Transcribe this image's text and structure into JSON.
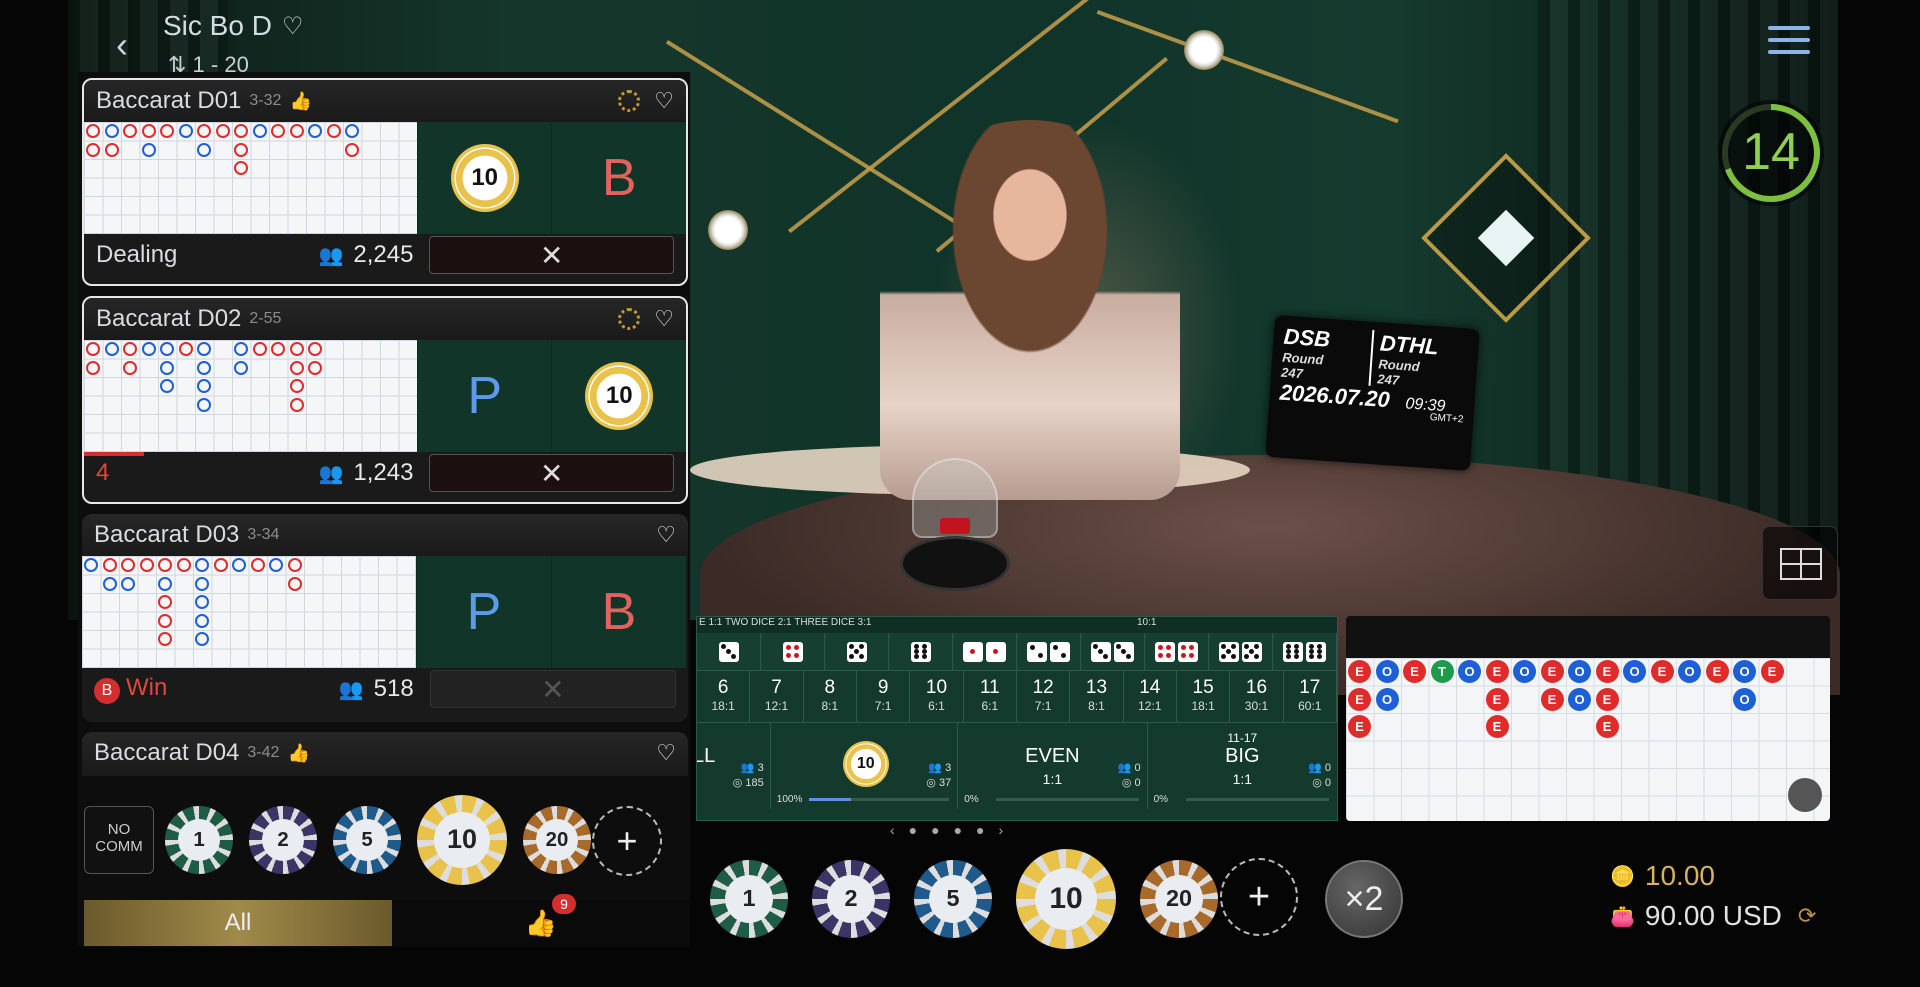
{
  "header": {
    "title": "Sic Bo D",
    "limits": "1 - 20",
    "timer": "14"
  },
  "studio_board": {
    "left_label": "DSB",
    "left_round_label": "Round",
    "left_round": "247",
    "right_label": "DTHL",
    "right_round_label": "Round",
    "right_round": "247",
    "date": "2026.07.20",
    "time": "09:39",
    "tz": "GMT+2"
  },
  "lobby": {
    "cards": [
      {
        "name": "Baccarat D01",
        "limit": "3-32",
        "status": "Dealing",
        "players": "2,245",
        "left_cell": "10",
        "right_cell": "B"
      },
      {
        "name": "Baccarat D02",
        "limit": "2-55",
        "status": "4",
        "players": "1,243",
        "left_cell": "P",
        "right_cell": "10"
      },
      {
        "name": "Baccarat D03",
        "limit": "3-34",
        "status": "Win",
        "status_badge": "B",
        "players": "518",
        "left_cell": "P",
        "right_cell": "B"
      },
      {
        "name": "Baccarat D04",
        "limit": "3-42"
      }
    ],
    "no_comm": "NO COMM",
    "chips": [
      "1",
      "2",
      "5",
      "10",
      "20"
    ],
    "tab_all": "All",
    "fav_count": "9"
  },
  "board": {
    "header_left": "E 1:1  TWO DICE 2:1  THREE DICE 3:1",
    "header_right": "10:1",
    "sums": [
      {
        "n": "6",
        "p": "18:1"
      },
      {
        "n": "7",
        "p": "12:1"
      },
      {
        "n": "8",
        "p": "8:1"
      },
      {
        "n": "9",
        "p": "7:1"
      },
      {
        "n": "10",
        "p": "6:1"
      },
      {
        "n": "11",
        "p": "6:1"
      },
      {
        "n": "12",
        "p": "7:1"
      },
      {
        "n": "13",
        "p": "8:1"
      },
      {
        "n": "14",
        "p": "12:1"
      },
      {
        "n": "15",
        "p": "18:1"
      },
      {
        "n": "16",
        "p": "30:1"
      },
      {
        "n": "17",
        "p": "60:1"
      }
    ],
    "small": {
      "title": "LL",
      "players": "3",
      "amount": "185"
    },
    "middle": {
      "chip": "10",
      "players": "3",
      "amount": "37",
      "pct": "100%",
      "fill": 0.3
    },
    "even": {
      "title": "EVEN",
      "pay": "1:1",
      "players": "0",
      "amount": "0",
      "pct": "0%"
    },
    "big": {
      "range": "11-17",
      "title": "BIG",
      "pay": "1:1",
      "players": "0",
      "amount": "0",
      "pct": "0%"
    }
  },
  "result_road": [
    [
      "E",
      "O",
      "E",
      "T",
      "O",
      "E",
      "O",
      "E",
      "O",
      "E",
      "O",
      "E",
      "O",
      "E",
      "O",
      "E"
    ],
    [
      "E",
      "O",
      "",
      "",
      "",
      "E",
      "",
      "E",
      "O",
      "E",
      "",
      "",
      "",
      "",
      "O",
      ""
    ],
    [
      "E",
      "",
      "",
      "",
      "",
      "E",
      "",
      "",
      "",
      "E",
      "",
      "",
      "",
      "",
      "",
      ""
    ]
  ],
  "bottom_chips": [
    "1",
    "2",
    "5",
    "10",
    "20"
  ],
  "x2_label": "×2",
  "balance": {
    "bet": "10.00",
    "wallet": "90.00 USD"
  },
  "colors": {
    "accent_gold": "#d9b25b",
    "felt": "#143a2d",
    "banker": "#e4625c",
    "player": "#5b9be8"
  }
}
